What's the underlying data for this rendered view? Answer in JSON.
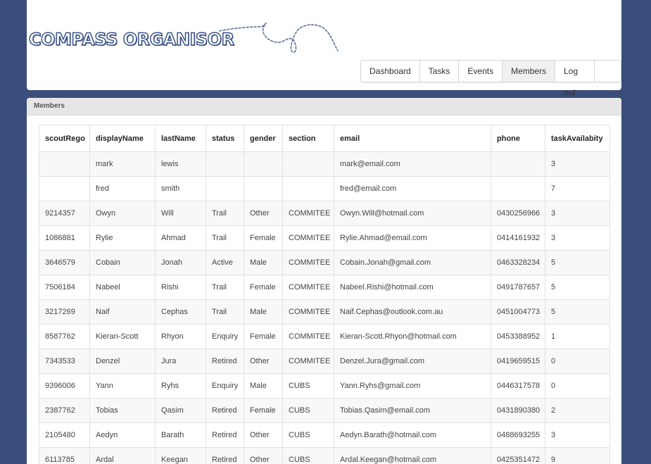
{
  "header": {
    "logo": "COMPASS ORGANISOR",
    "nav": [
      "Dashboard",
      "Tasks",
      "Events",
      "Members",
      "Log out"
    ],
    "active_nav": "Members"
  },
  "panel": {
    "title": "Members",
    "columns": [
      "scoutRego",
      "displayName",
      "lastName",
      "status",
      "gender",
      "section",
      "email",
      "phone",
      "taskAvailabity"
    ],
    "rows": [
      [
        "",
        "mark",
        "lewis",
        "",
        "",
        "",
        "mark@email.com",
        "",
        "3"
      ],
      [
        "",
        "fred",
        "smith",
        "",
        "",
        "",
        "fred@email.com",
        "",
        "7"
      ],
      [
        "9214357",
        "Owyn",
        "Will",
        "Trail",
        "Other",
        "COMMITEE",
        "Owyn.Will@hotmail.com",
        "0430256966",
        "3"
      ],
      [
        "1086881",
        "Rylie",
        "Ahmad",
        "Trail",
        "Female",
        "COMMITEE",
        "Rylie.Ahmad@email.com",
        "0414161932",
        "3"
      ],
      [
        "3646579",
        "Cobain",
        "Jonah",
        "Active",
        "Male",
        "COMMITEE",
        "Cobain.Jonah@gmail.com",
        "0463328234",
        "5"
      ],
      [
        "7506184",
        "Nabeel",
        "Rishi",
        "Trail",
        "Female",
        "COMMITEE",
        "Nabeel.Rishi@hotmail.com",
        "0491787657",
        "5"
      ],
      [
        "3217269",
        "Naif",
        "Cephas",
        "Trail",
        "Male",
        "COMMITEE",
        "Naif.Cephas@outlook.com.au",
        "0451004773",
        "5"
      ],
      [
        "8587762",
        "Kieran-Scott",
        "Rhyon",
        "Enquiry",
        "Female",
        "COMMITEE",
        "Kieran-Scott.Rhyon@hotmail.com",
        "0453388952",
        "1"
      ],
      [
        "7343533",
        "Denzel",
        "Jura",
        "Retired",
        "Other",
        "COMMITEE",
        "Denzel.Jura@gmail.com",
        "0419659515",
        "0"
      ],
      [
        "9396006",
        "Yann",
        "Ryhs",
        "Enquiry",
        "Male",
        "CUBS",
        "Yann.Ryhs@gmail.com",
        "0446317578",
        "0"
      ],
      [
        "2387762",
        "Tobias",
        "Qasim",
        "Retired",
        "Female",
        "CUBS",
        "Tobias.Qasim@email.com",
        "0431890380",
        "2"
      ],
      [
        "2105480",
        "Aedyn",
        "Barath",
        "Retired",
        "Other",
        "CUBS",
        "Aedyn.Barath@hotmail.com",
        "0488693255",
        "3"
      ],
      [
        "6113785",
        "Ardal",
        "Keegan",
        "Retired",
        "Other",
        "CUBS",
        "Ardal.Keegan@hotmail.com",
        "0425351472",
        "9"
      ]
    ]
  },
  "colors": {
    "background": "#3a4d7a",
    "logo_outline": "#3c5386"
  }
}
